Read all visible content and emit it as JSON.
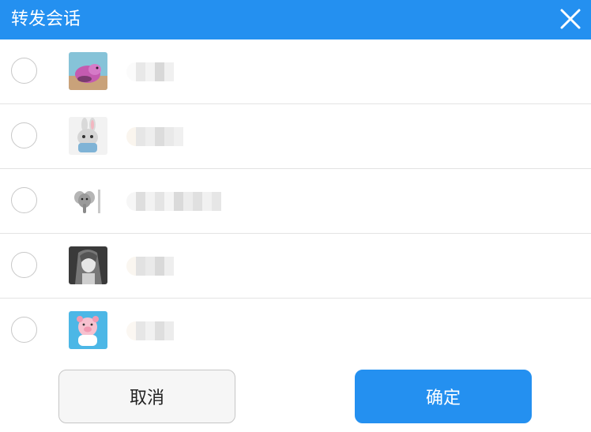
{
  "dialog": {
    "title": "转发会话",
    "close_icon": "close-icon"
  },
  "conversations": [
    {
      "avatar": "guinea-pig-avatar",
      "name_hidden": true
    },
    {
      "avatar": "bunny-avatar",
      "name_hidden": true
    },
    {
      "avatar": "elephant-avatar",
      "name_hidden": true
    },
    {
      "avatar": "anime-girl-avatar",
      "name_hidden": true
    },
    {
      "avatar": "pig-toy-avatar",
      "name_hidden": true
    }
  ],
  "footer": {
    "cancel_label": "取消",
    "confirm_label": "确定"
  },
  "colors": {
    "accent": "#2490f0",
    "divider": "#e3e3e3",
    "radio_border": "#c8c8c8"
  }
}
